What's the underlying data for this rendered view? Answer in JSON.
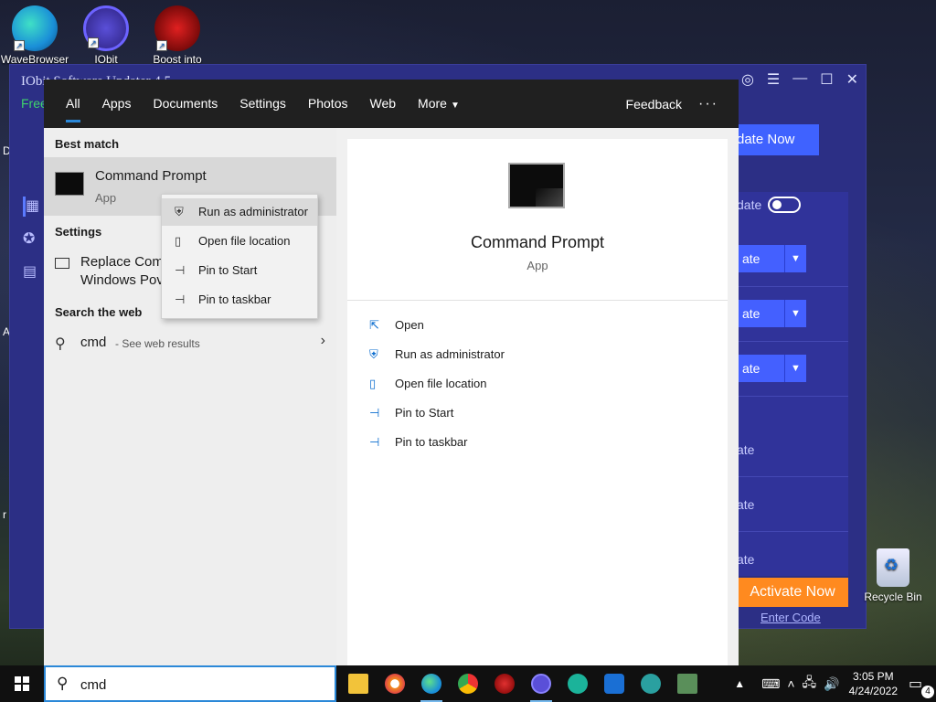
{
  "desktop": {
    "icons": [
      {
        "label": "WaveBrowser",
        "icon": "wavebrowser-icon"
      },
      {
        "label": "IObit",
        "icon": "iobit-icon"
      },
      {
        "label": "Boost into",
        "icon": "boost-icon"
      }
    ],
    "recycle_bin": "Recycle Bin",
    "left_letters": [
      "D",
      "A",
      "r"
    ]
  },
  "iobit_window": {
    "title": "IObit Software Updater 4.5",
    "subtitle": "Free",
    "update_now": "date Now",
    "auto_update_label": "date",
    "row_buttons": [
      "ate",
      "ate",
      "ate"
    ],
    "row_labels": [
      "ate",
      "ate",
      "ate"
    ],
    "activate_now": "Activate Now",
    "enter_code": "Enter Code"
  },
  "search": {
    "tabs": [
      "All",
      "Apps",
      "Documents",
      "Settings",
      "Photos",
      "Web",
      "More"
    ],
    "active_tab": "All",
    "feedback": "Feedback",
    "more_options": "···",
    "best_match_header": "Best match",
    "best_match": {
      "name": "Command Prompt",
      "type": "App"
    },
    "settings_header": "Settings",
    "settings_item": {
      "line1": "Replace Comm",
      "line2": "Windows Pov"
    },
    "web_header": "Search the web",
    "web_item": {
      "query": "cmd",
      "suffix": "- See web results"
    },
    "preview": {
      "name": "Command Prompt",
      "type": "App",
      "actions": [
        "Open",
        "Run as administrator",
        "Open file location",
        "Pin to Start",
        "Pin to taskbar"
      ]
    }
  },
  "context_menu": {
    "items": [
      "Run as administrator",
      "Open file location",
      "Pin to Start",
      "Pin to taskbar"
    ],
    "highlighted": "Run as administrator"
  },
  "taskbar": {
    "search_value": "cmd",
    "apps": [
      "file-explorer-icon",
      "browser-icon",
      "edge-icon",
      "chrome-icon",
      "antivirus-icon",
      "iobit-icon",
      "uninstaller-icon",
      "defender-icon",
      "driver-booster-icon",
      "task-manager-icon"
    ],
    "time": "3:05 PM",
    "date": "4/24/2022",
    "notification_count": "4"
  },
  "colors": {
    "accent": "#2b88d8",
    "iobit_bg": "#2c2f85",
    "activate": "#ff8a1f"
  }
}
